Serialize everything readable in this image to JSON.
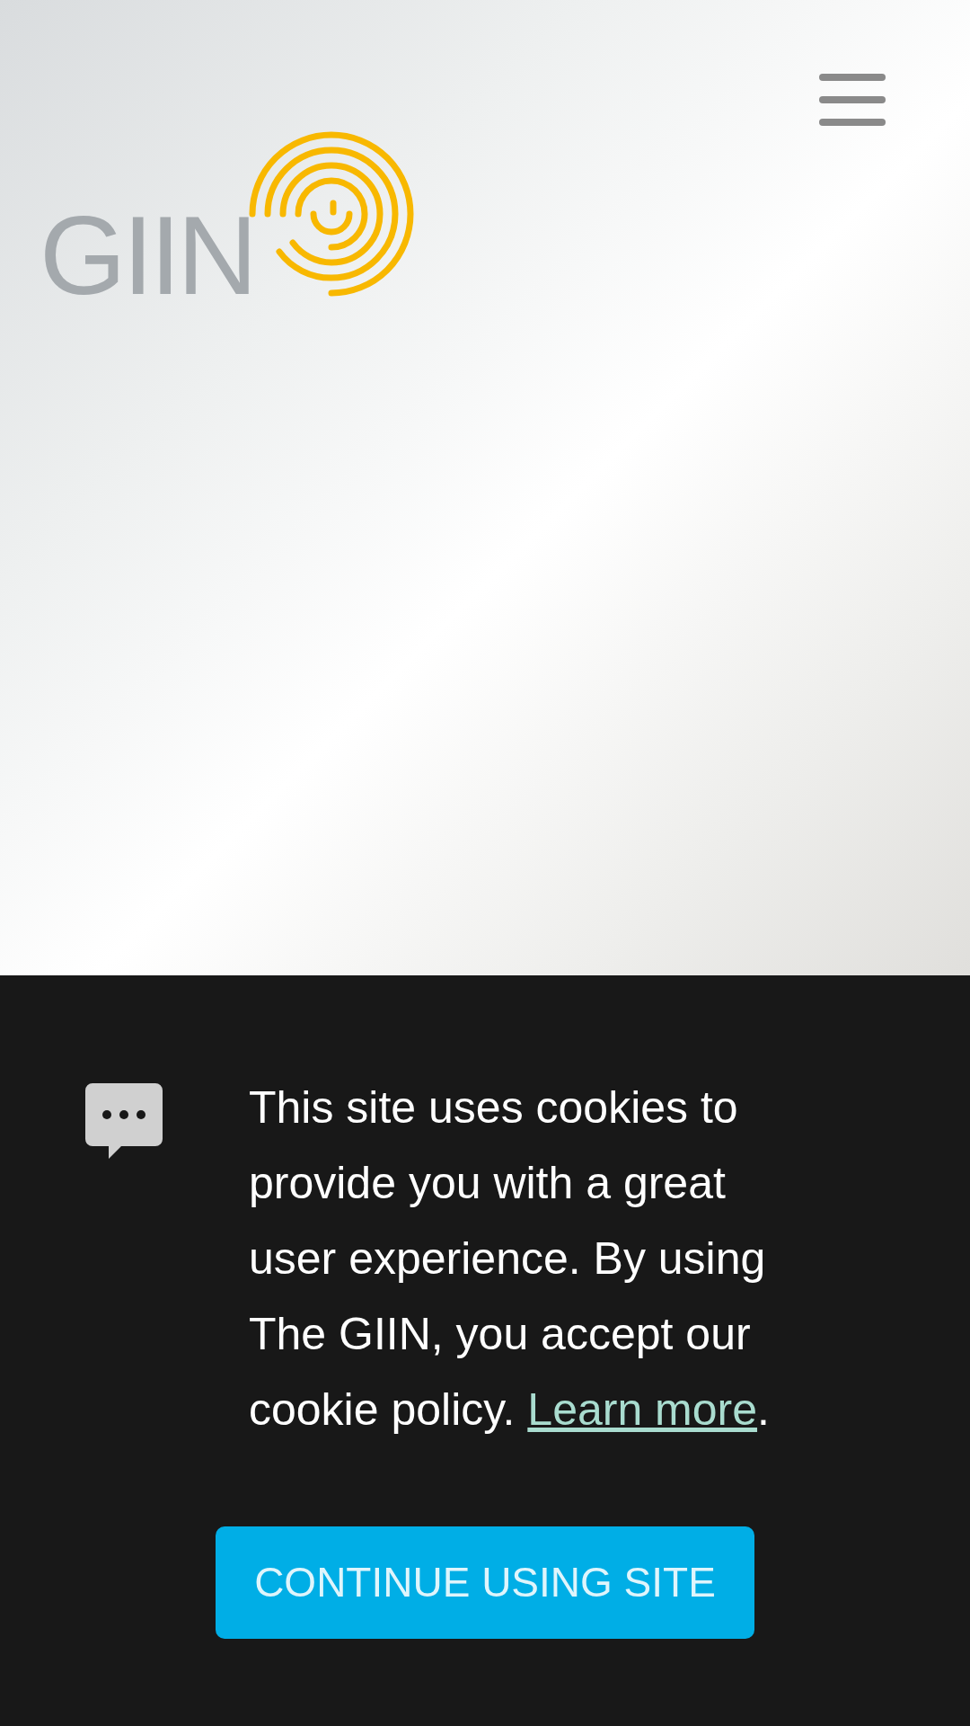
{
  "header": {
    "logo_text": "GIIN"
  },
  "cookie_banner": {
    "message": "This site uses cookies to provide you with a great user experience. By using The GIIN, you accept our cookie policy.",
    "link": "Learn more",
    "after_link": ".",
    "button": "CONTINUE USING SITE"
  }
}
